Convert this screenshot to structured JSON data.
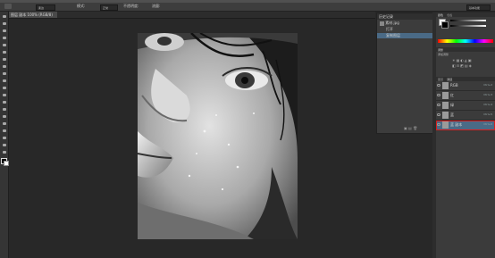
{
  "app": {
    "name": "Photoshop"
  },
  "document": {
    "tab_label": "图层 副本 100% (RGB/8)"
  },
  "options_bar": {
    "tool_size": "柔边",
    "mode_label": "模式:",
    "mode_value": "正常",
    "opacity_label": "不透明度:",
    "flow_label": "流量:",
    "workspace_button": "基本功能"
  },
  "history_panel": {
    "tab": "历史记录",
    "items": [
      {
        "label": "素材.jpg"
      },
      {
        "label": "打开"
      },
      {
        "label": "复制图层"
      }
    ]
  },
  "color_panel": {
    "tab": "颜色",
    "tab2": "色板"
  },
  "adjust_panel": {
    "tab": "调整",
    "hint": "添加调整"
  },
  "layers_panel": {
    "tab": "图层",
    "tab2": "通道",
    "items": [
      {
        "name": "蓝",
        "mode": "Ctrl+5"
      },
      {
        "name": "红",
        "mode": "Ctrl+3"
      },
      {
        "name": "绿",
        "mode": "Ctrl+4"
      },
      {
        "name": "RGB",
        "mode": "Ctrl+2"
      },
      {
        "name": "蓝 副本",
        "mode": "Ctrl+6",
        "highlighted": true
      }
    ]
  },
  "colors": {
    "highlight": "#d81c1c",
    "selection": "#4a6a86"
  }
}
